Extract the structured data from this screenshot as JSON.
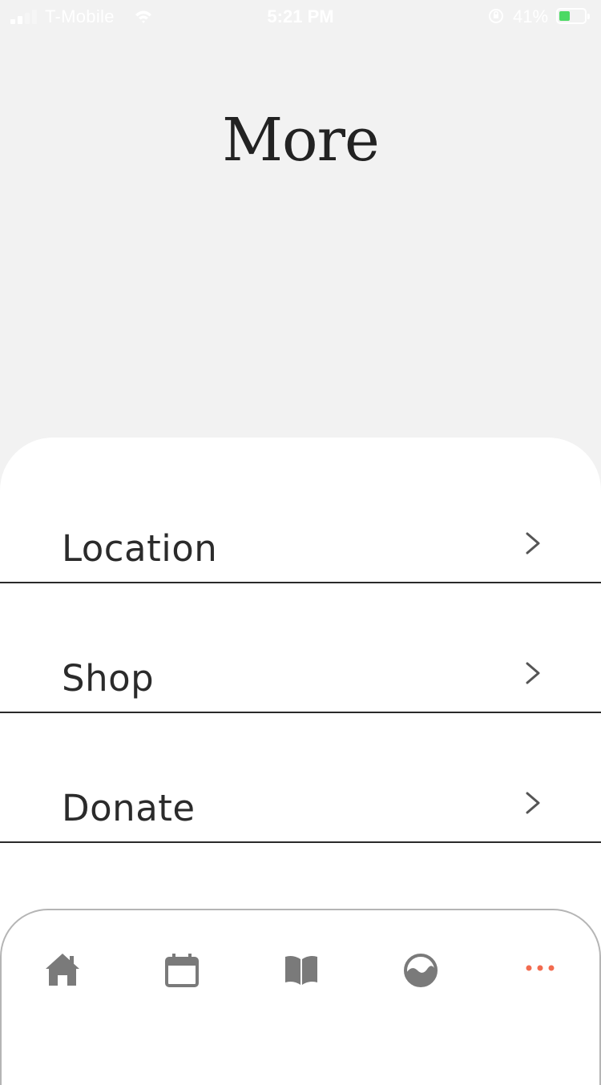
{
  "status_bar": {
    "carrier": "T-Mobile",
    "time": "5:21 PM",
    "battery_percent": "41%",
    "icons": [
      "signal-icon",
      "wifi-icon",
      "orientation-lock-icon",
      "battery-charging-icon"
    ]
  },
  "header": {
    "title": "More"
  },
  "menu": {
    "items": [
      {
        "label": "Location",
        "icon": "chevron-right-icon"
      },
      {
        "label": "Shop",
        "icon": "chevron-right-icon"
      },
      {
        "label": "Donate",
        "icon": "chevron-right-icon"
      }
    ]
  },
  "tab_bar": {
    "tabs": [
      {
        "icon": "home-icon",
        "active": false
      },
      {
        "icon": "calendar-icon",
        "active": false
      },
      {
        "icon": "book-icon",
        "active": false
      },
      {
        "icon": "gallery-icon",
        "active": false
      },
      {
        "icon": "more-dots-icon",
        "active": true
      }
    ]
  },
  "colors": {
    "background": "#f2f2f2",
    "sheet": "#ffffff",
    "text": "#2b2b2b",
    "tab_icon_inactive": "#7a7a7a",
    "tab_icon_active": "#f26b4f",
    "divider": "#2a2a2a",
    "battery_charge": "#4cd964"
  }
}
